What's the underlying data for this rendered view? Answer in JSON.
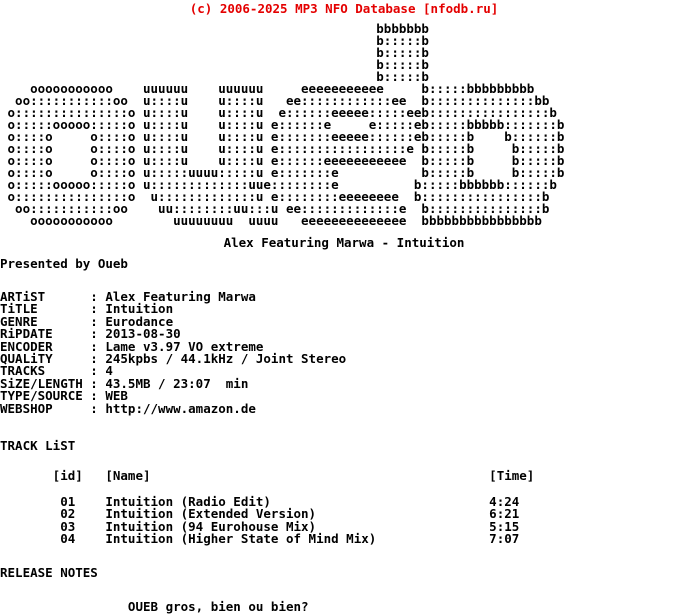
{
  "header": {
    "text": "(c) 2006-2025 MP3 NFO Database [nfodb.ru]",
    "color": "#e40000"
  },
  "ascii_art": {
    "name": "oueb-logo-ascii",
    "lines": [
      "                                                  bbbbbbb             ",
      "                                                  b:::::b             ",
      "                                                  b:::::b             ",
      "                                                  b:::::b             ",
      "                                                  b:::::b             ",
      "    ooooooooooo    uuuuuu    uuuuuu     eeeeeeeeeee     b:::::bbbbbbbbb    ",
      "  oo:::::::::::oo  u::::u    u::::u   ee::::::::::::ee  b::::::::::::::bb  ",
      " o:::::::::::::::o u::::u    u::::u  e::::::eeeee:::::eeb::::::::::::::::b ",
      " o:::::ooooo:::::o u::::u    u::::u e::::::e     e:::::eb:::::bbbbb:::::::b",
      " o::::o     o::::o u::::u    u::::u e:::::::eeeee::::::eb:::::b    b::::::b",
      " o::::o     o::::o u::::u    u::::u e:::::::::::::::::e b:::::b     b:::::b",
      " o::::o     o::::o u::::u    u::::u e::::::eeeeeeeeeee  b:::::b     b:::::b",
      " o::::o     o::::o u:::::uuuu:::::u e:::::::e           b:::::b     b:::::b",
      " o:::::ooooo:::::o u:::::::::::::uue::::::::e          b:::::bbbbbb::::::b",
      " o:::::::::::::::o  u:::::::::::::u e::::::::eeeeeeee  b::::::::::::::::b ",
      "  oo:::::::::::oo    uu::::::::uu:::u ee:::::::::::::e  b:::::::::::::::b  ",
      "    ooooooooooo        uuuuuuuu  uuuu   eeeeeeeeeeeeee  bbbbbbbbbbbbbbbb   "
    ]
  },
  "release_title": "Alex Featuring Marwa - Intuition",
  "presented_by": "Presented by Oueb",
  "metadata": {
    "rows": [
      {
        "label": "ARTiST",
        "sep": ":",
        "value": "Alex Featuring Marwa"
      },
      {
        "label": "TiTLE",
        "sep": ":",
        "value": "Intuition"
      },
      {
        "label": "GENRE",
        "sep": ":",
        "value": "Eurodance"
      },
      {
        "label": "RiPDATE",
        "sep": ":",
        "value": "2013-08-30"
      },
      {
        "label": "ENCODER",
        "sep": ":",
        "value": "Lame v3.97 VO extreme"
      },
      {
        "label": "QUALiTY",
        "sep": ":",
        "value": "245kpbs / 44.1kHz / Joint Stereo"
      },
      {
        "label": "TRACKS",
        "sep": ":",
        "value": "4"
      },
      {
        "label": "SiZE/LENGTH",
        "sep": ":",
        "value": "43.5MB / 23:07  min"
      },
      {
        "label": "TYPE/SOURCE",
        "sep": ":",
        "value": "WEB"
      },
      {
        "label": "WEBSHOP",
        "sep": ":",
        "value": "http://www.amazon.de"
      }
    ]
  },
  "tracklist": {
    "heading": "TRACK LiST",
    "columns": {
      "id": "[id]",
      "name": "[Name]",
      "time": "[Time]"
    },
    "tracks": [
      {
        "id": "01",
        "name": "Intuition (Radio Edit)",
        "time": "4:24"
      },
      {
        "id": "02",
        "name": "Intuition (Extended Version)",
        "time": "6:21"
      },
      {
        "id": "03",
        "name": "Intuition (94 Eurohouse Mix)",
        "time": "5:15"
      },
      {
        "id": "04",
        "name": "Intuition (Higher State of Mind Mix)",
        "time": "7:07"
      }
    ]
  },
  "release_notes": {
    "heading": "RELEASE NOTES",
    "body": "OUEB gros, bien ou bien?"
  }
}
